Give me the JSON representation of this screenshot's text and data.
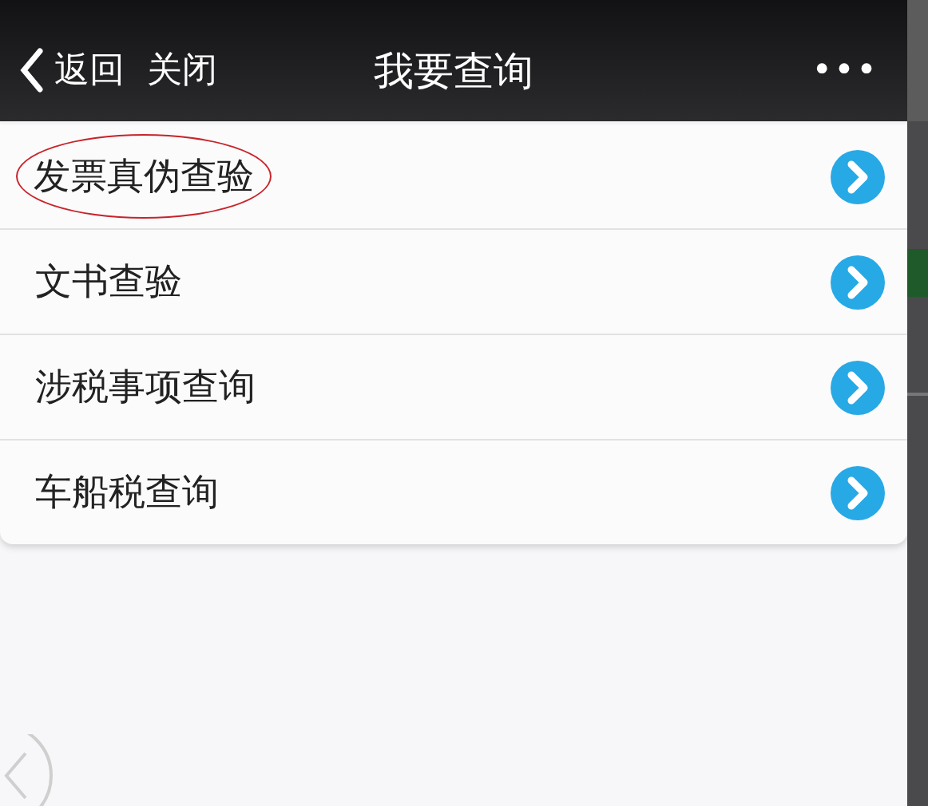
{
  "nav_bar": {
    "back": "返回",
    "close": "关闭",
    "title": "我要查询",
    "more": "•••"
  },
  "menu_items": [
    {
      "label": "发票真伪查验",
      "circled": true
    },
    {
      "label": "文书查验",
      "circled": false
    },
    {
      "label": "涉税事项查询",
      "circled": false
    },
    {
      "label": "车船税查询",
      "circled": false
    }
  ]
}
